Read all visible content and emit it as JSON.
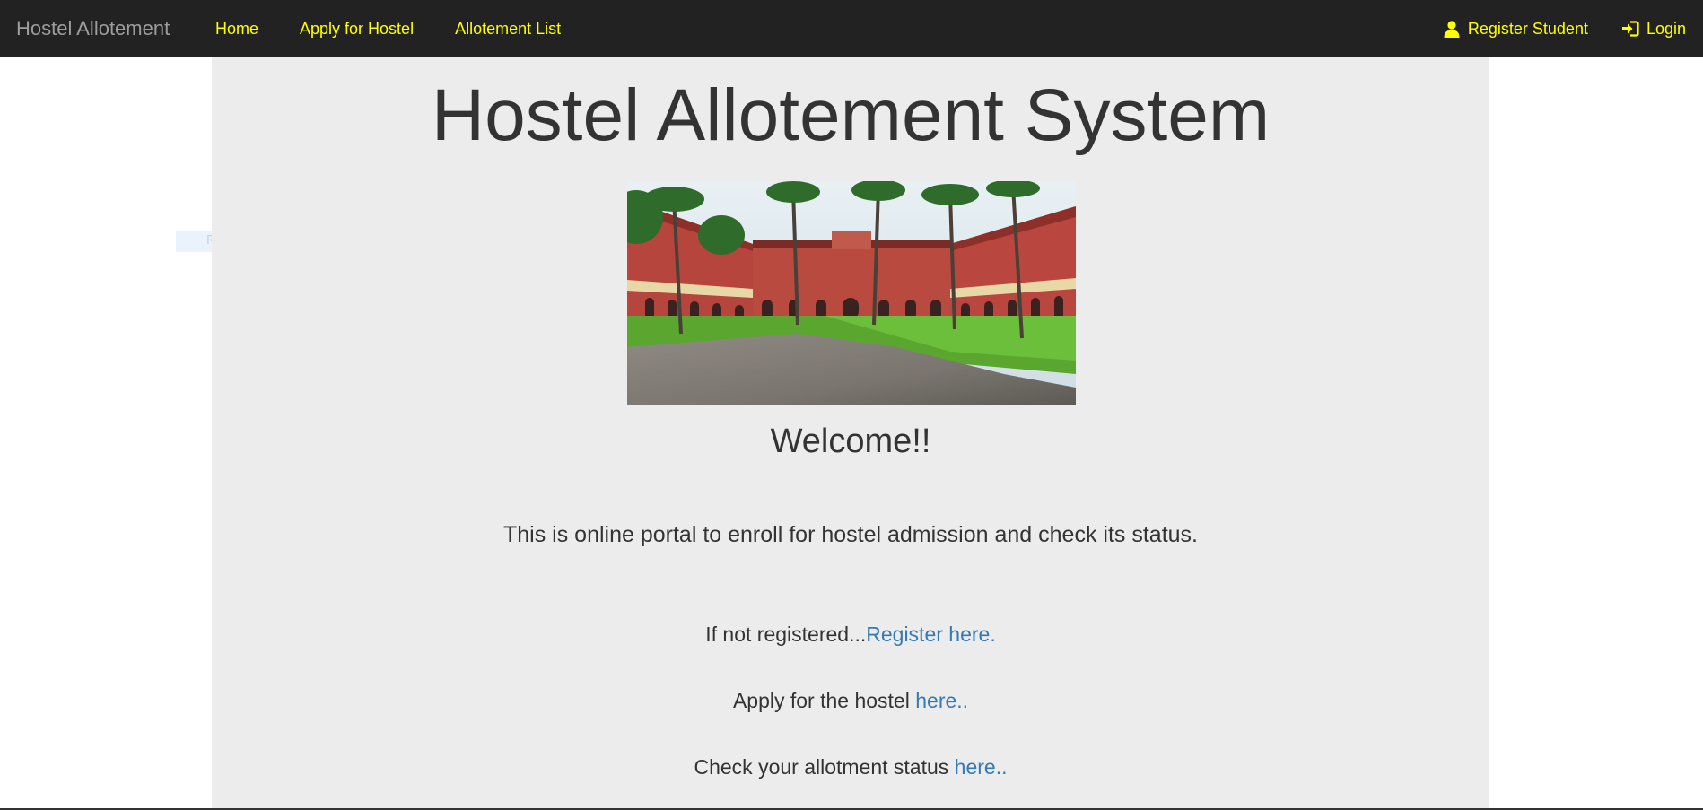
{
  "navbar": {
    "brand": "Hostel Allotement",
    "links": [
      {
        "label": "Home"
      },
      {
        "label": "Apply for Hostel"
      },
      {
        "label": "Allotement List"
      }
    ],
    "right_links": [
      {
        "label": "Register Student",
        "icon": "user-icon"
      },
      {
        "label": "Login",
        "icon": "log-in-icon"
      }
    ],
    "colors": {
      "background": "#222222",
      "link": "#ffff00",
      "brand": "#9d9d9d"
    }
  },
  "main": {
    "title": "Hostel Allotement System",
    "image": {
      "icon": "hostel-building-photo"
    },
    "welcome": "Welcome!!",
    "intro": "This is online portal to enroll for hostel admission and check its status.",
    "register_line": {
      "text": "If not registered...",
      "link": "Register here."
    },
    "apply_line": {
      "text": "Apply for the hostel ",
      "link": "here.."
    },
    "status_line": {
      "text": "Check your allotment status ",
      "link": "here.."
    },
    "colors": {
      "panel": "#ececec",
      "text": "#333333",
      "link": "#337ab7"
    }
  },
  "overlay": {
    "snip_label": "Rectangular Snip"
  }
}
